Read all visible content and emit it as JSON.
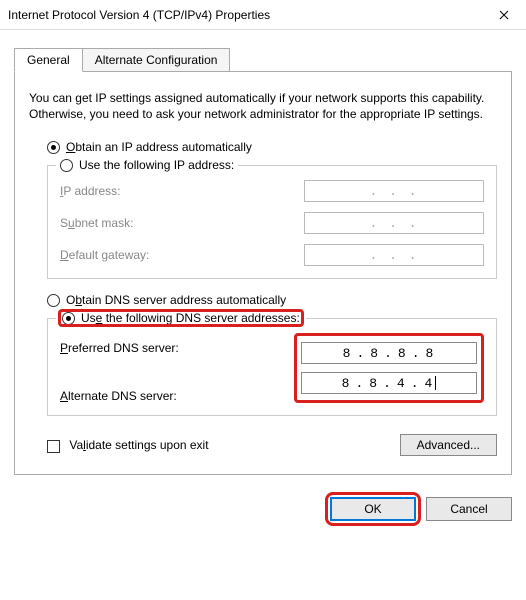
{
  "window": {
    "title": "Internet Protocol Version 4 (TCP/IPv4) Properties"
  },
  "tabs": {
    "general": "General",
    "alternate": "Alternate Configuration"
  },
  "intro": "You can get IP settings assigned automatically if your network supports this capability. Otherwise, you need to ask your network administrator for the appropriate IP settings.",
  "ip": {
    "auto_label_pre": "O",
    "auto_label_rest": "btain an IP address automatically",
    "manual_label_pre": "Use the following IP address:",
    "manual_prefix": "",
    "addr_label_u": "I",
    "addr_label_rest": "P address:",
    "mask_label_pre": "S",
    "mask_label_u": "u",
    "mask_label_rest": "bnet mask:",
    "gw_label_u": "D",
    "gw_label_rest": "efault gateway:"
  },
  "dns": {
    "auto_label_pre": "O",
    "auto_label_u": "b",
    "auto_label_rest": "tain DNS server address automatically",
    "manual_label_pre": "Us",
    "manual_label_u": "e",
    "manual_label_rest": " the following DNS server addresses:",
    "pref_label_u": "P",
    "pref_label_rest": "referred DNS server:",
    "alt_label_u": "A",
    "alt_label_rest": "lternate DNS server:",
    "preferred": [
      "8",
      "8",
      "8",
      "8"
    ],
    "alternate": [
      "8",
      "8",
      "4",
      "4"
    ]
  },
  "validate_label_pre": "Va",
  "validate_label_u": "l",
  "validate_label_rest": "idate settings upon exit",
  "advanced_label": "Advanced...",
  "ok_label": "OK",
  "cancel_label": "Cancel",
  "dot": ".",
  "placeholder_dots": ".       .       ."
}
